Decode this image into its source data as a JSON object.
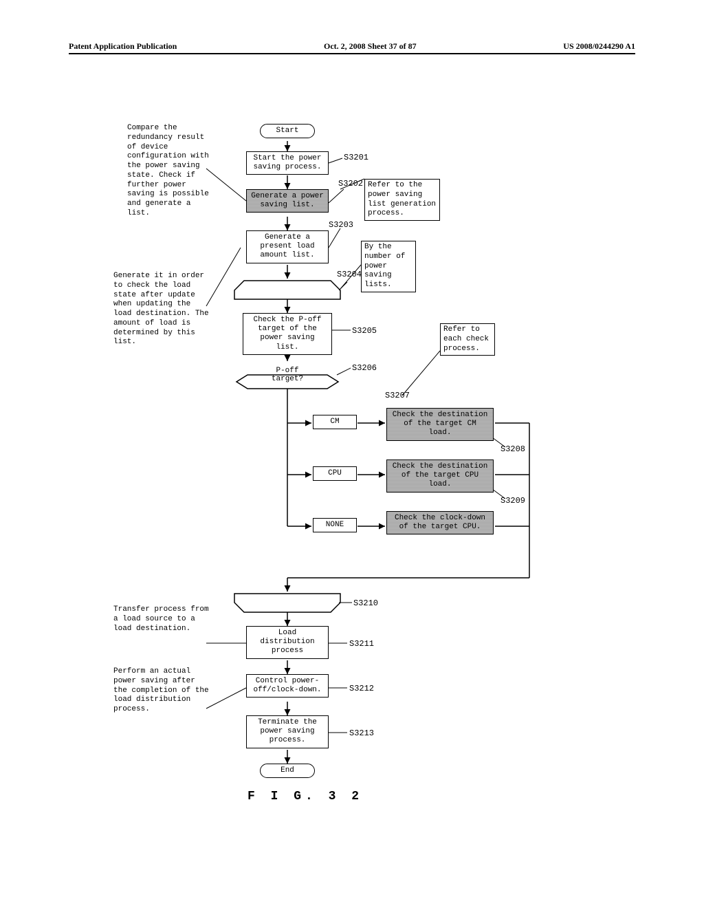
{
  "header": {
    "left": "Patent Application Publication",
    "center": "Oct. 2, 2008  Sheet 37 of 87",
    "right": "US 2008/0244290 A1"
  },
  "figure_label": "F I G.  3 2",
  "steps": {
    "start": "Start",
    "s3201": "Start the power saving process.",
    "s3202": "Generate a power saving list.",
    "s3203": "Generate a present load amount list.",
    "s3204_loop_top": "",
    "s3205": "Check the P-off target of the power saving list.",
    "s3206": "P-off target?",
    "s3207_cm": "CM",
    "s3207_cpu": "CPU",
    "s3207_none": "NONE",
    "s3207_a": "Check the destination of the target CM load.",
    "s3208_a": "Check the destination of the target CPU load.",
    "s3209_a": "Check the clock-down of the target CPU.",
    "s3210_loop_bottom": "",
    "s3211": "Load distribution process",
    "s3212": "Control power-off/clock-down.",
    "s3213": "Terminate the power saving process.",
    "end": "End"
  },
  "step_labels": {
    "s3201": "S3201",
    "s3202": "S3202",
    "s3203": "S3203",
    "s3204": "S3204",
    "s3205": "S3205",
    "s3206": "S3206",
    "s3207": "S3207",
    "s3208": "S3208",
    "s3209": "S3209",
    "s3210": "S3210",
    "s3211": "S3211",
    "s3212": "S3212",
    "s3213": "S3213"
  },
  "annotations": {
    "a1": "Compare the redundancy result of device configuration with the power saving state. Check if further power saving is possible and generate a list.",
    "a2": "Refer to the power saving list generation process.",
    "a3": "By the number of power saving lists.",
    "a4": "Generate it in order to check the load state after update when updating the load destination. The amount of load is determined by this list.",
    "a5": "Refer to each check process.",
    "a6": "Transfer process from a load source to a load destination.",
    "a7": "Perform an actual power saving after the completion of the load distribution process."
  }
}
